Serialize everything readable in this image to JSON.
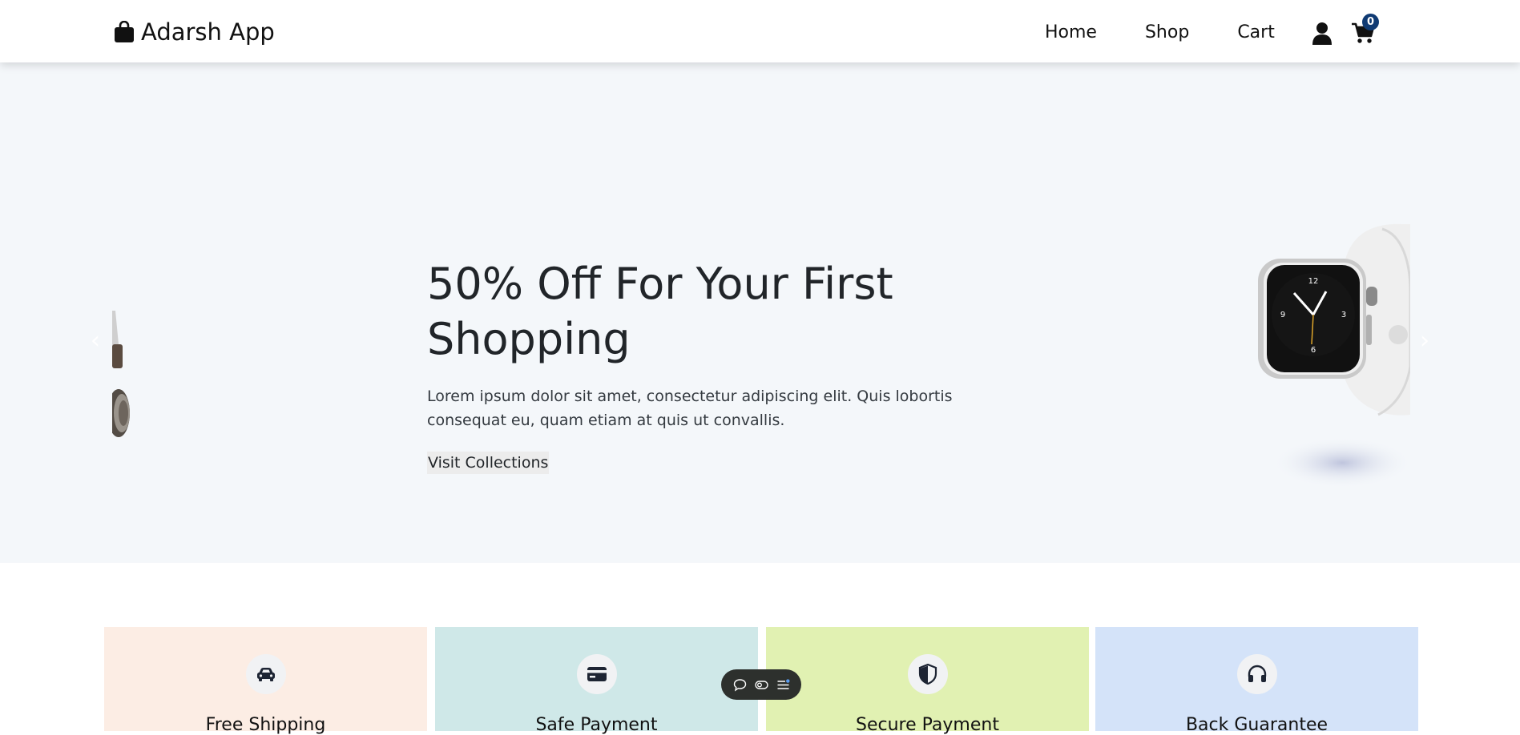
{
  "nav": {
    "brand": "Adarsh App",
    "links": [
      "Home",
      "Shop",
      "Cart"
    ],
    "cart_count": "0",
    "icons": {
      "brand": "shopping-bag-icon",
      "user": "user-icon",
      "cart": "cart-icon"
    }
  },
  "hero": {
    "title": "50% Off For Your First Shopping",
    "text": "Lorem ipsum dolor sit amet, consectetur adipiscing elit. Quis lobortis consequat eu, quam etiam at quis ut convallis.",
    "button_label": "Visit Collections",
    "arrows": {
      "prev": "‹",
      "next": "›"
    },
    "images": {
      "current": "smartwatch",
      "previous": "headphones"
    }
  },
  "features": [
    {
      "title": "Free Shipping",
      "icon": "car-icon",
      "color": "#fcede4"
    },
    {
      "title": "Safe Payment",
      "icon": "credit-card-icon",
      "color": "#cfe8e8"
    },
    {
      "title": "Secure Payment",
      "icon": "shield-icon",
      "color": "#e1f1b2"
    },
    {
      "title": "Back Guarantee",
      "icon": "headphones-icon",
      "color": "#d4e3f9"
    }
  ],
  "toolbar": {
    "icons": [
      "comment-icon",
      "toggle-icon",
      "list-icon"
    ]
  },
  "colors": {
    "hero_bg": "#f4f7fa",
    "badge": "#0f3a73",
    "toolbar": "#2d302d"
  }
}
